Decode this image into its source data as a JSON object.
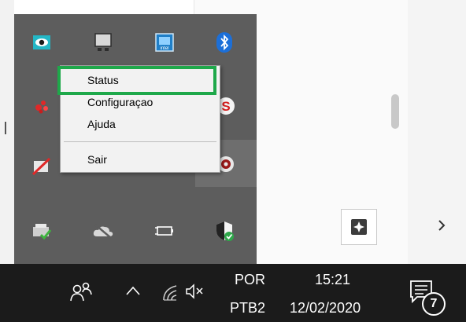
{
  "tray_menu": {
    "items": [
      {
        "label": "Status"
      },
      {
        "label": "Configuraçao"
      },
      {
        "label": "Ajuda"
      },
      {
        "label": "Sair"
      }
    ]
  },
  "tray_icons": [
    "eye-icon",
    "remote-desktop-icon",
    "intel-graphics-icon",
    "bluetooth-icon",
    "app-red-icon",
    "app-red-s-icon",
    "network-disabled-icon",
    "orange-app-icon",
    "record-icon",
    "printer-check-icon",
    "onedrive-offline-icon",
    "battery-plug-icon",
    "windows-security-icon"
  ],
  "taskbar": {
    "language_code": "POR",
    "keyboard_layout": "PTB2",
    "time": "15:21",
    "date": "12/02/2020",
    "notification_count": "7"
  },
  "colors": {
    "focus_outline": "#1ea84a",
    "tray_background": "#5d5d5d",
    "taskbar_background": "#1b1b1b"
  }
}
